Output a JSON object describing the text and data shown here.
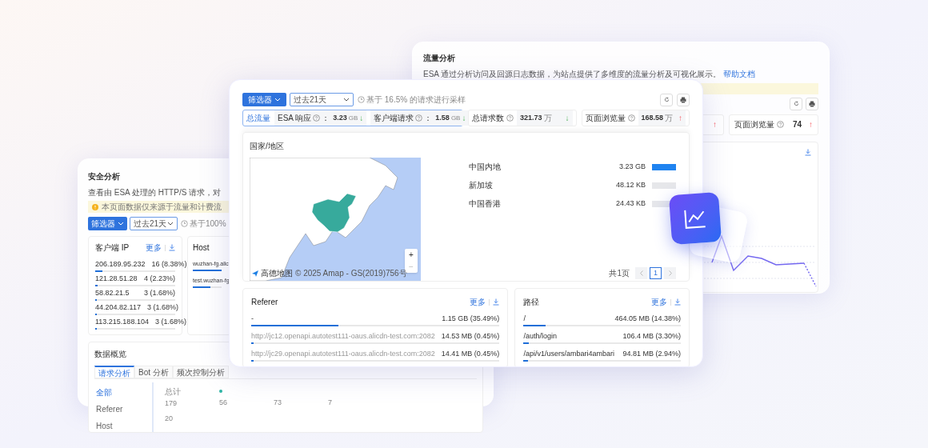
{
  "traffic_panel": {
    "title": "流量分析",
    "description": "ESA 通过分析访问及回源日志数据，为站点提供了多维度的流量分析及可视化展示。",
    "help_link": "帮助文档",
    "metrics": [
      {
        "kind": "partial",
        "arrow": "↑",
        "rising": true
      },
      {
        "kind": "full",
        "label": "页面浏览量",
        "value": "74",
        "arrow": "↑",
        "rising": true
      }
    ]
  },
  "security_panel": {
    "title": "安全分析",
    "description": "查看由 ESA 处理的 HTTP/S 请求，对",
    "notice": "本页面数据仅来源于流量和计费流",
    "filter_button": "筛选器",
    "time_range": "过去21天",
    "sampling": "基于100%",
    "client_ip": {
      "title": "客户端 IP",
      "more": "更多",
      "rows": [
        {
          "name": "206.189.95.232",
          "value": "16 (8.38%)",
          "level": 0.09
        },
        {
          "name": "121.28.51.28",
          "value": "4 (2.23%)",
          "level": 0.03
        },
        {
          "name": "58.82.21.5",
          "value": "3 (1.68%)",
          "level": 0.02
        },
        {
          "name": "44.204.82.117",
          "value": "3 (1.68%)",
          "level": 0.02
        },
        {
          "name": "113.215.188.104",
          "value": "3 (1.68%)",
          "level": 0.02
        }
      ]
    },
    "host": {
      "title": "Host",
      "rows": [
        {
          "name": "wuzhan-fg.alic",
          "level": 1
        },
        {
          "name": "test.wuzhan-fg",
          "level": 0.6
        }
      ]
    },
    "overview": {
      "title": "数据概览",
      "tabs": [
        {
          "label": "请求分析",
          "selected": true
        },
        {
          "label": "Bot 分析",
          "selected": false
        },
        {
          "label": "频次控制分析",
          "selected": false
        }
      ],
      "menu": [
        {
          "label": "全部",
          "selected": true
        },
        {
          "label": "Referer",
          "selected": false
        },
        {
          "label": "Host",
          "selected": false
        }
      ],
      "stats": [
        {
          "label": "总计",
          "value": "179"
        },
        {
          "value": "56",
          "color": "#2fb5a5"
        },
        {
          "value": "73"
        },
        {
          "value": "7"
        }
      ],
      "y_label": "20"
    }
  },
  "main_panel": {
    "filter_button": "筛选器",
    "time_range": "过去21天",
    "sampling": "基于 16.5% 的请求进行采样",
    "total": {
      "label": "总流量",
      "items": [
        {
          "label": "ESA 响应",
          "colon": "：",
          "value": "3.23",
          "unit": "GB",
          "arrow": "↓",
          "rising": false
        },
        {
          "label": "客户端请求",
          "colon": "：",
          "value": "1.58",
          "unit": "GB",
          "arrow": "↓",
          "rising": false
        }
      ]
    },
    "metrics": [
      {
        "label": "总请求数",
        "value": "321.73",
        "unit": "万",
        "arrow": "↓",
        "rising": false
      },
      {
        "label": "页面浏览量",
        "value": "168.58",
        "unit": "万",
        "arrow": "↑",
        "rising": true
      }
    ],
    "region": {
      "title": "国家/地区",
      "map_logo": "高德地图",
      "map_attribution": "© 2025 Amap - GS(2019)756号",
      "zoom_in": "+",
      "zoom_out": "−",
      "rows": [
        {
          "name": "中国内地",
          "value": "3.23 GB",
          "level": 1
        },
        {
          "name": "新加坡",
          "value": "48.12 KB",
          "level": 0
        },
        {
          "name": "中国香港",
          "value": "24.43 KB",
          "level": 0
        }
      ],
      "page_total": "共1页",
      "pages": [
        {
          "label": "1",
          "selected": true
        }
      ]
    },
    "referer": {
      "title": "Referer",
      "more": "更多",
      "rows": [
        {
          "name": "-",
          "value": "1.15 GB (35.49%)",
          "level": 0.35,
          "blurred": false
        },
        {
          "name": "http://jc12.openapi.autotest111-oaus.alicdn-test.com:2082",
          "value": "14.53 MB (0.45%)",
          "level": 0.005,
          "blurred": true
        },
        {
          "name": "http://jc29.openapi.autotest111-oaus.alicdn-test.com:2082",
          "value": "14.41 MB (0.45%)",
          "level": 0.005,
          "blurred": true
        }
      ]
    },
    "path": {
      "title": "路径",
      "more": "更多",
      "rows": [
        {
          "name": "/",
          "value": "464.05 MB (14.38%)",
          "level": 0.14,
          "blurred": false
        },
        {
          "name": "/auth/login",
          "value": "106.4 MB (3.30%)",
          "level": 0.033,
          "blurred": false
        },
        {
          "name": "/api/v1/users/ambari4ambari",
          "value": "94.81 MB (2.94%)",
          "level": 0.029,
          "blurred": false
        }
      ]
    }
  }
}
